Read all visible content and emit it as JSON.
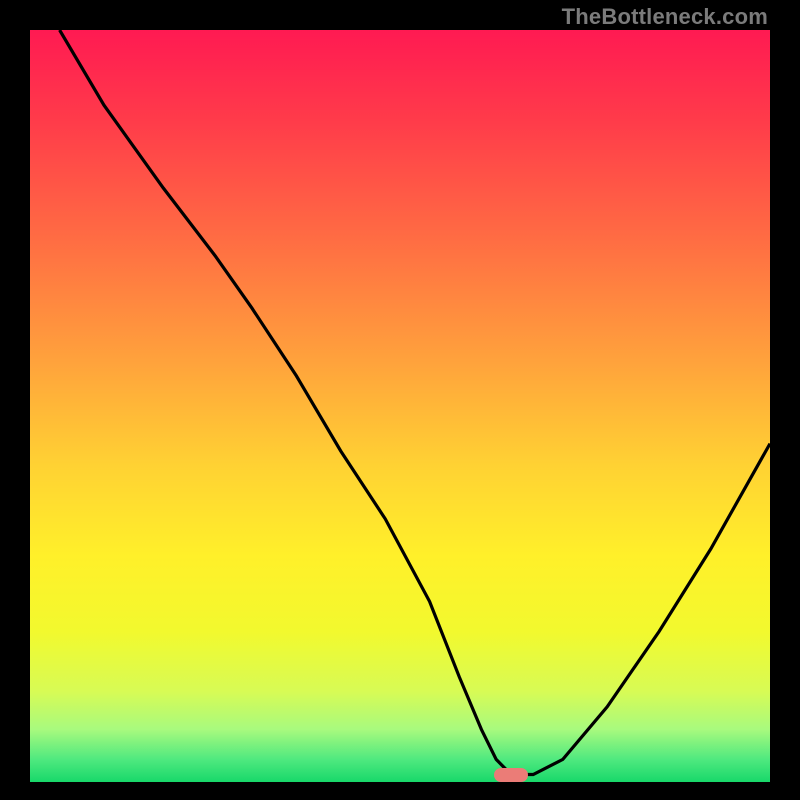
{
  "watermark": "TheBottleneck.com",
  "marker": {
    "x_pct": 65,
    "y_pct": 99.1
  },
  "chart_data": {
    "type": "line",
    "title": "",
    "xlabel": "",
    "ylabel": "",
    "xlim": [
      0,
      100
    ],
    "ylim": [
      0,
      100
    ],
    "grid": false,
    "legend": false,
    "series": [
      {
        "name": "bottleneck-curve",
        "x": [
          4,
          10,
          18,
          25,
          30,
          36,
          42,
          48,
          54,
          58,
          61,
          63,
          65,
          68,
          72,
          78,
          85,
          92,
          100
        ],
        "y": [
          100,
          90,
          79,
          70,
          63,
          54,
          44,
          35,
          24,
          14,
          7,
          3,
          1,
          1,
          3,
          10,
          20,
          31,
          45
        ]
      }
    ],
    "gradient_colors": {
      "top": "#ff1a52",
      "mid1": "#ff6d43",
      "mid2": "#ffd233",
      "mid3": "#f2f92e",
      "bottom": "#18d86a"
    },
    "marker_color": "#eb7c77"
  }
}
